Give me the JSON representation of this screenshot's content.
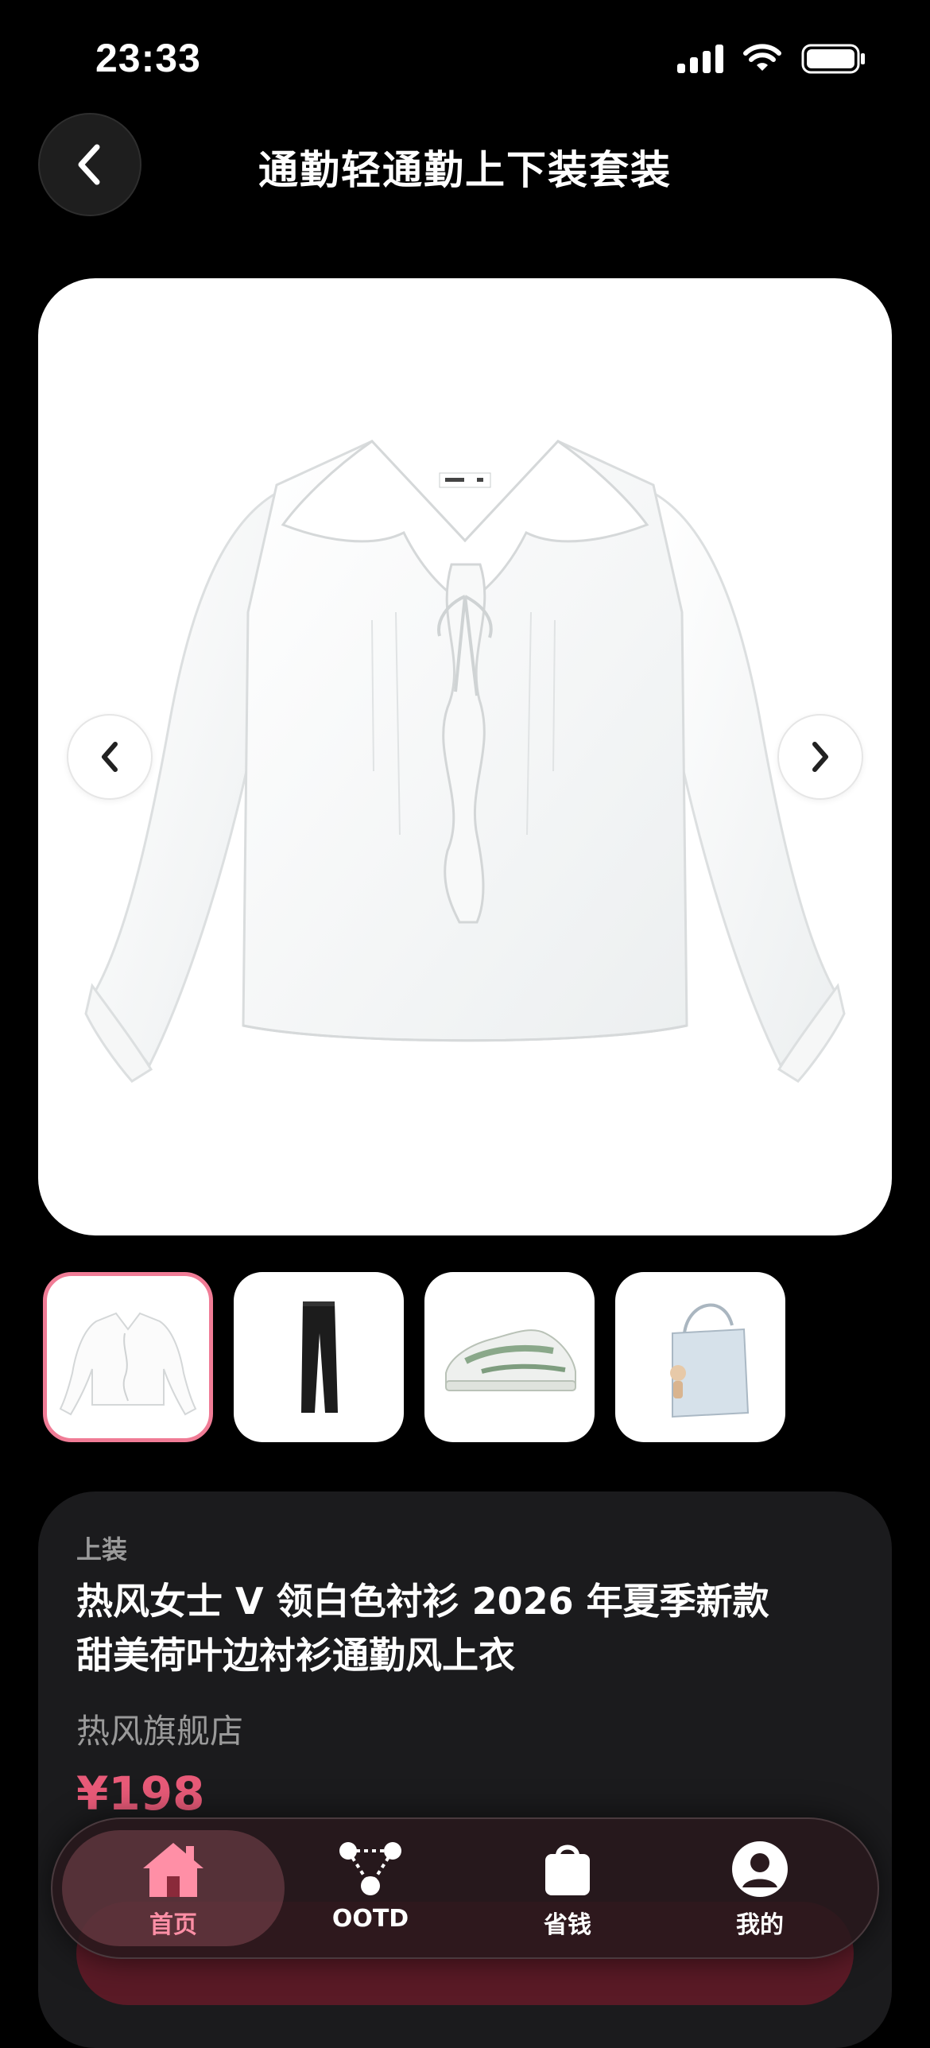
{
  "status_bar": {
    "time": "23:33"
  },
  "header": {
    "title": "通勤轻通勤上下装套装"
  },
  "thumbnails": [
    {
      "item": "白色荷叶边衬衫",
      "active": true
    },
    {
      "item": "黑色长裤",
      "active": false
    },
    {
      "item": "绿白运动鞋",
      "active": false
    },
    {
      "item": "浅蓝手提包",
      "active": false
    }
  ],
  "product": {
    "category": "上装",
    "name_line1": "热风女士 V 领白色衬衫 2026 年夏季新款",
    "name_line2": "甜美荷叶边衬衫通勤风上衣",
    "store": "热风旗舰店",
    "price": "¥198"
  },
  "tab_bar": {
    "items": [
      {
        "label": "首页",
        "icon": "home-icon",
        "active": true
      },
      {
        "label": "OOTD",
        "icon": "outfit-graph-icon",
        "active": false
      },
      {
        "label": "省钱",
        "icon": "shopping-bag-icon",
        "active": false
      },
      {
        "label": "我的",
        "icon": "profile-icon",
        "active": false
      }
    ]
  },
  "colors": {
    "accent": "#e85a78",
    "tab_active": "#ff8fa6",
    "background": "#000000",
    "card": "#1b1b1d"
  }
}
